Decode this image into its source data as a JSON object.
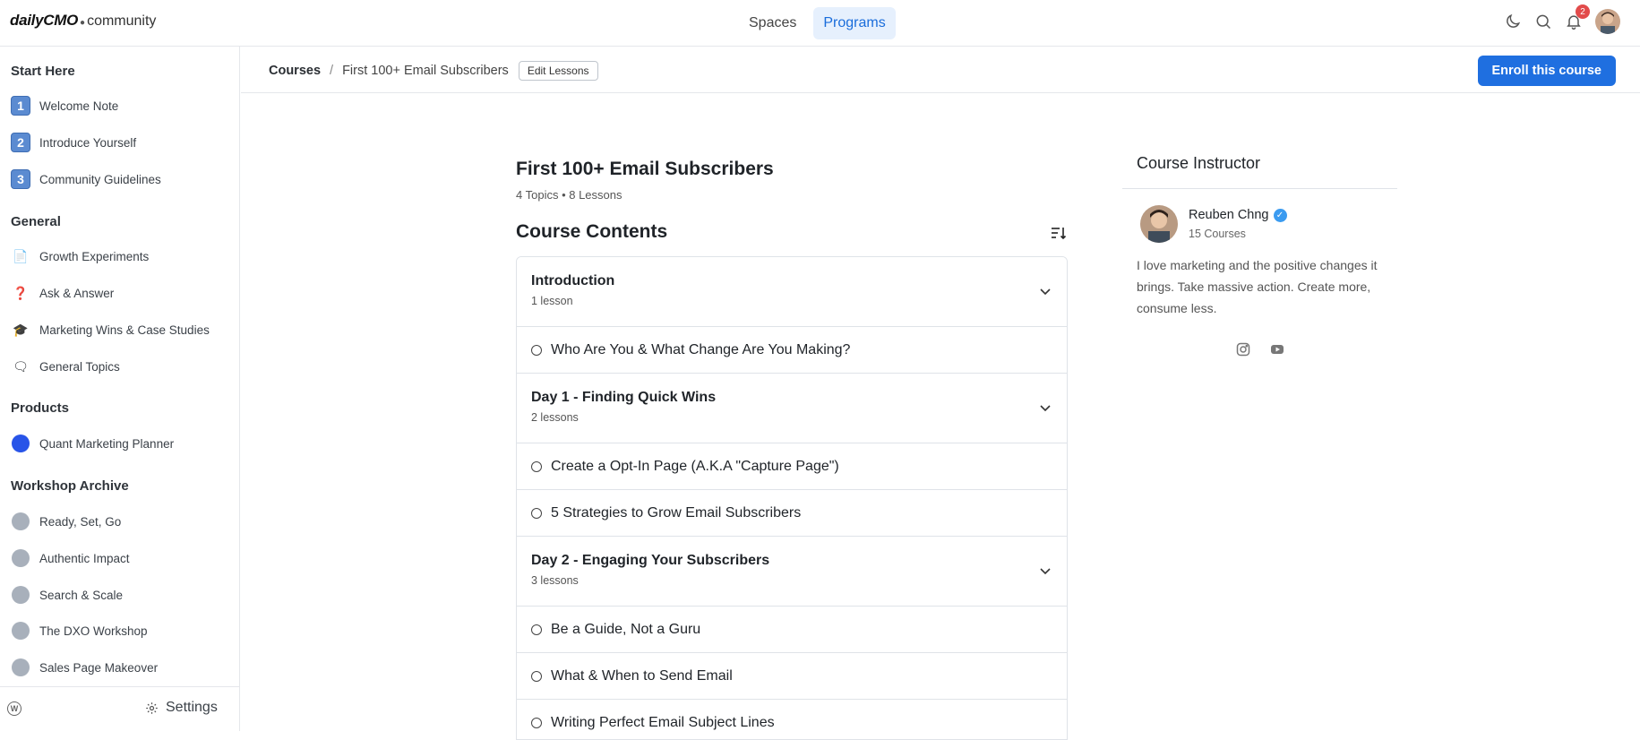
{
  "header": {
    "logo_brand": "dailyCMO",
    "logo_sub": "community",
    "nav": [
      {
        "label": "Spaces",
        "active": false
      },
      {
        "label": "Programs",
        "active": true
      }
    ],
    "notification_count": "2",
    "icons": [
      "moon-icon",
      "search-icon",
      "bell-icon",
      "avatar"
    ]
  },
  "sidebar": {
    "sections": [
      {
        "title": "Start Here",
        "items": [
          {
            "icon": "1",
            "label": "Welcome Note"
          },
          {
            "icon": "2",
            "label": "Introduce Yourself"
          },
          {
            "icon": "3",
            "label": "Community Guidelines"
          }
        ]
      },
      {
        "title": "General",
        "items": [
          {
            "icon": "📄",
            "label": "Growth Experiments"
          },
          {
            "icon": "❓",
            "label": "Ask & Answer"
          },
          {
            "icon": "🎓",
            "label": "Marketing Wins & Case Studies"
          },
          {
            "icon": "🗨",
            "label": "General Topics"
          }
        ]
      },
      {
        "title": "Products",
        "items": [
          {
            "icon": "blue-circle",
            "label": "Quant Marketing Planner"
          }
        ]
      },
      {
        "title": "Workshop Archive",
        "items": [
          {
            "icon": "grey-circle",
            "label": "Ready, Set, Go"
          },
          {
            "icon": "grey-circle",
            "label": "Authentic Impact"
          },
          {
            "icon": "grey-circle",
            "label": "Search & Scale"
          },
          {
            "icon": "grey-circle",
            "label": "The DXO Workshop"
          },
          {
            "icon": "grey-circle",
            "label": "Sales Page Makeover"
          }
        ]
      }
    ],
    "settings_label": "Settings"
  },
  "breadcrumb": {
    "root": "Courses",
    "separator": "/",
    "current": "First 100+ Email Subscribers",
    "edit_label": "Edit Lessons"
  },
  "enroll_label": "Enroll this course",
  "course": {
    "title": "First 100+ Email Subscribers",
    "meta": "4 Topics • 8 Lessons",
    "contents_title": "Course Contents",
    "topics": [
      {
        "name": "Introduction",
        "count": "1 lesson",
        "lessons": [
          "Who Are You & What Change Are You Making?"
        ]
      },
      {
        "name": "Day 1 - Finding Quick Wins",
        "count": "2 lessons",
        "lessons": [
          "Create a Opt-In Page (A.K.A \"Capture Page\")",
          "5 Strategies to Grow Email Subscribers"
        ]
      },
      {
        "name": "Day 2 - Engaging Your Subscribers",
        "count": "3 lessons",
        "lessons": [
          "Be a Guide, Not a Guru",
          "What & When to Send Email",
          "Writing Perfect Email Subject Lines"
        ]
      }
    ]
  },
  "instructor": {
    "heading": "Course Instructor",
    "name": "Reuben Chng",
    "courses": "15 Courses",
    "bio": "I love marketing and the positive changes it brings. Take massive action. Create more, consume less.",
    "socials": [
      "instagram-icon",
      "youtube-icon"
    ]
  },
  "colors": {
    "accent": "#1f6fe0",
    "nav_active_bg": "#e6f0fd",
    "badge": "#e24b4b"
  }
}
